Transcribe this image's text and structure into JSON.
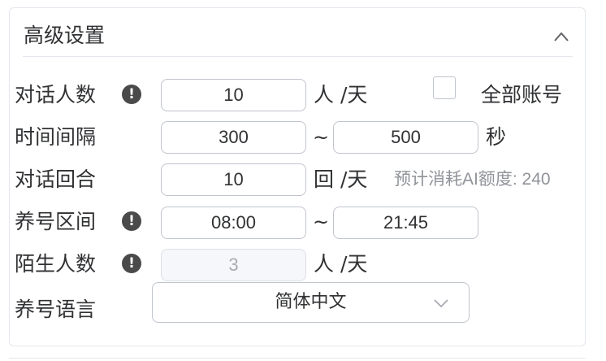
{
  "panel": {
    "title": "高级设置",
    "collapse_icon": "chevron-up-icon"
  },
  "rows": {
    "daily_chats": {
      "label": "对话人数",
      "value": "10",
      "unit": "人 /天",
      "info_icon": "exclamation-circle-icon"
    },
    "all_accounts": {
      "label": "全部账号",
      "checked": false
    },
    "interval": {
      "label": "时间间隔",
      "min": "300",
      "max": "500",
      "separator": "~",
      "unit": "秒"
    },
    "rounds": {
      "label": "对话回合",
      "value": "10",
      "unit": "回 /天",
      "hint": "预计消耗AI额度: 240"
    },
    "nurture_window": {
      "label": "养号区间",
      "start": "08:00",
      "end": "21:45",
      "separator": "~",
      "info_icon": "exclamation-circle-icon"
    },
    "strangers": {
      "label": "陌生人数",
      "value": "3",
      "unit": "人 /天",
      "disabled": true,
      "info_icon": "exclamation-circle-icon"
    },
    "language": {
      "label": "养号语言",
      "selected": "简体中文",
      "arrow_icon": "chevron-down-icon"
    }
  }
}
